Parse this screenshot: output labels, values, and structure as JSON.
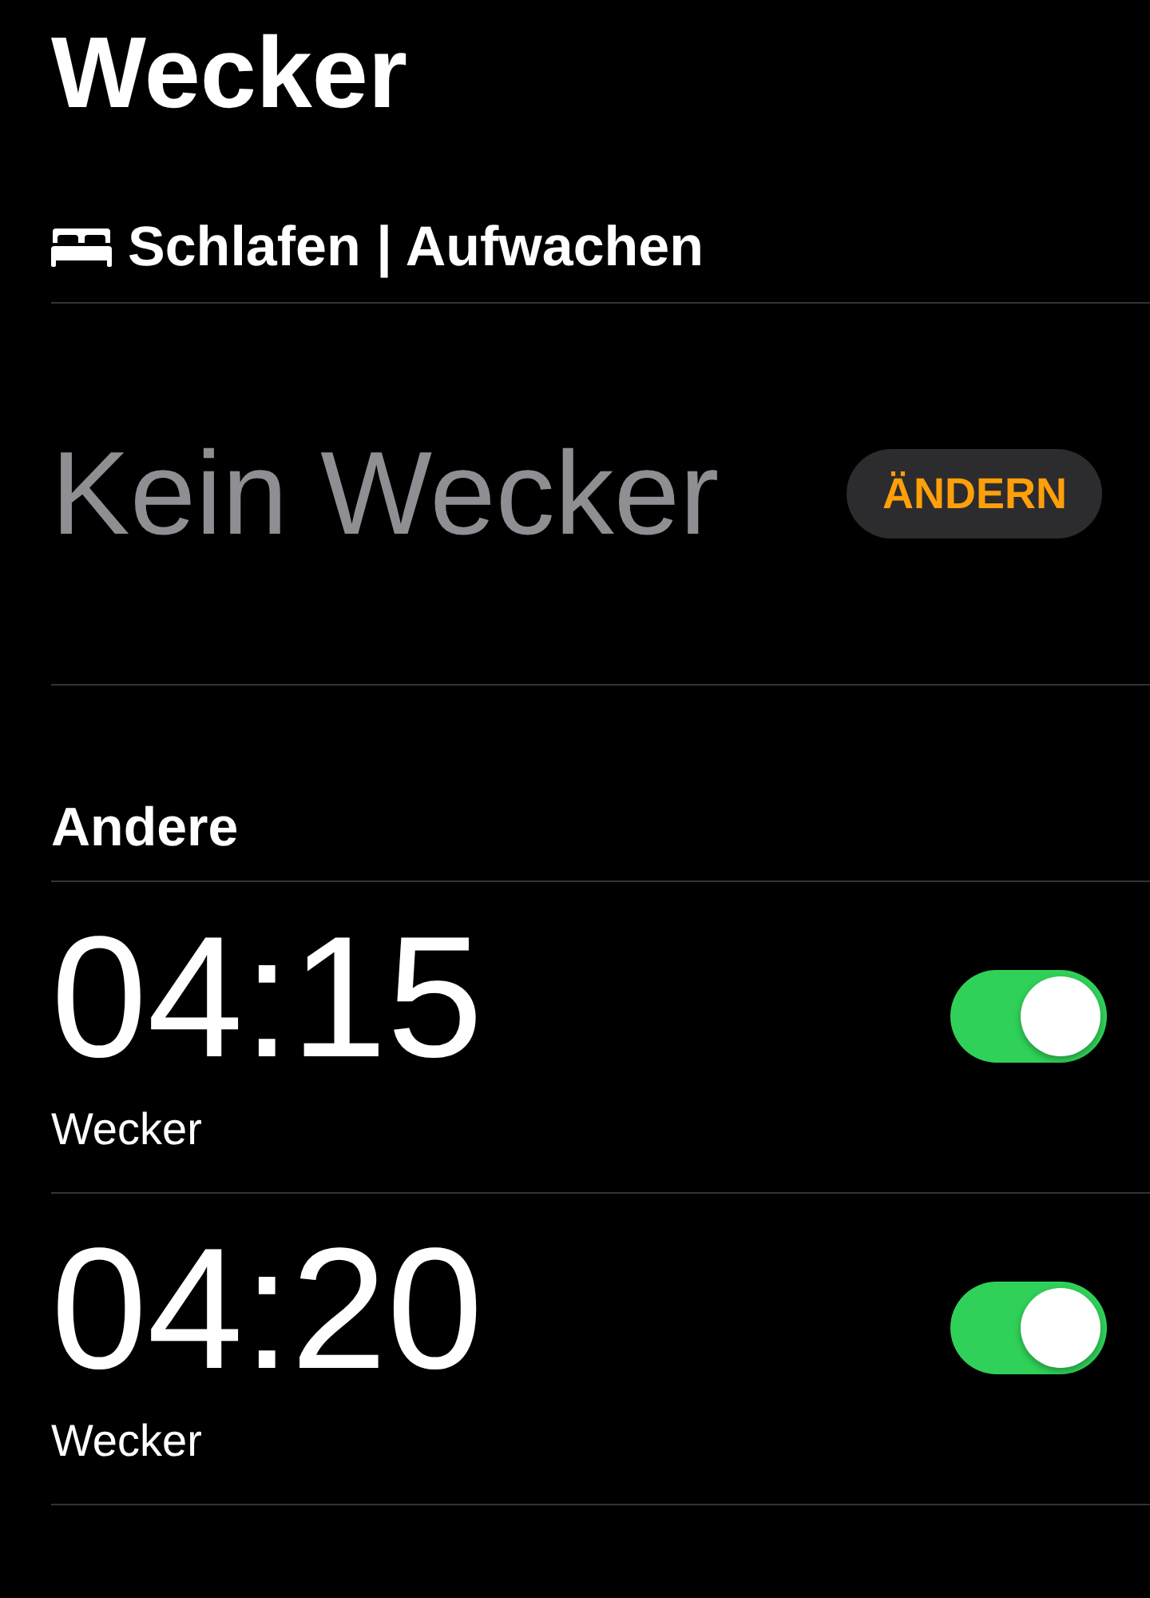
{
  "header": {
    "title": "Wecker"
  },
  "sleep": {
    "heading": "Schlafen | Aufwachen",
    "status": "Kein Wecker",
    "button": "ÄNDERN"
  },
  "others": {
    "heading": "Andere",
    "alarms": [
      {
        "time": "04:15",
        "label": "Wecker",
        "on": true
      },
      {
        "time": "04:20",
        "label": "Wecker",
        "on": true
      }
    ]
  }
}
